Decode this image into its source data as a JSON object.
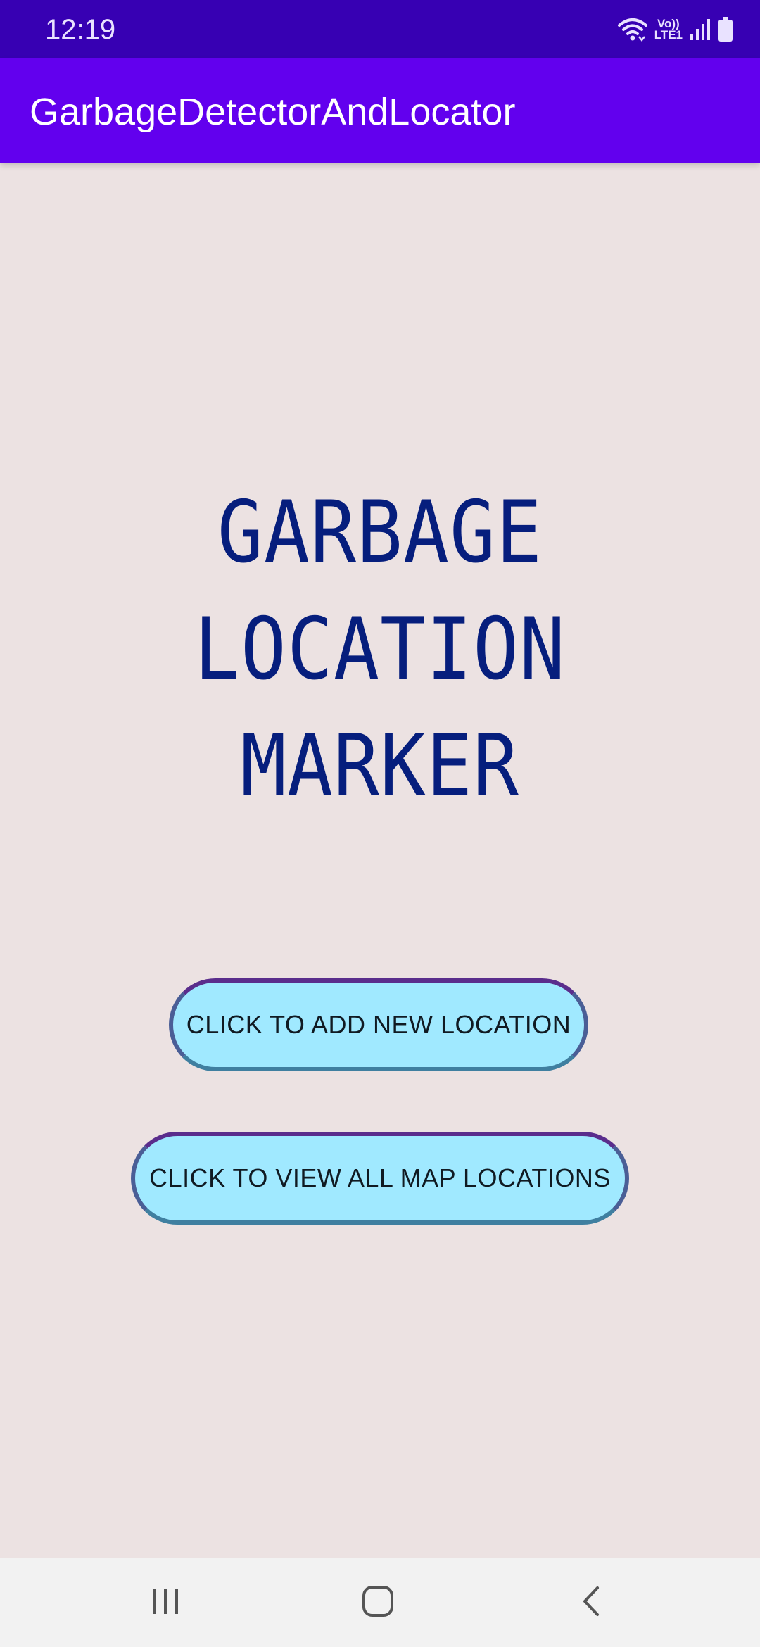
{
  "status_bar": {
    "time": "12:19",
    "icons": [
      "wifi-icon",
      "volte-lte-icon",
      "signal-icon",
      "battery-icon"
    ],
    "lte_label": "LTE1",
    "volte_label": "Vo))"
  },
  "app_bar": {
    "title": "GarbageDetectorAndLocator",
    "color": "#6200ee"
  },
  "main": {
    "headline_line1": "GARBAGE LOCATION",
    "headline_line2": "MARKER",
    "add_button_label": "CLICK TO ADD NEW LOCATION",
    "view_button_label": "CLICK TO VIEW ALL MAP LOCATIONS",
    "background_color": "#ece2e2",
    "button_fill_color": "#a0e9ff",
    "headline_color": "#061e7d"
  },
  "nav_bar": {
    "buttons": [
      "recents-icon",
      "home-icon",
      "back-icon"
    ]
  }
}
